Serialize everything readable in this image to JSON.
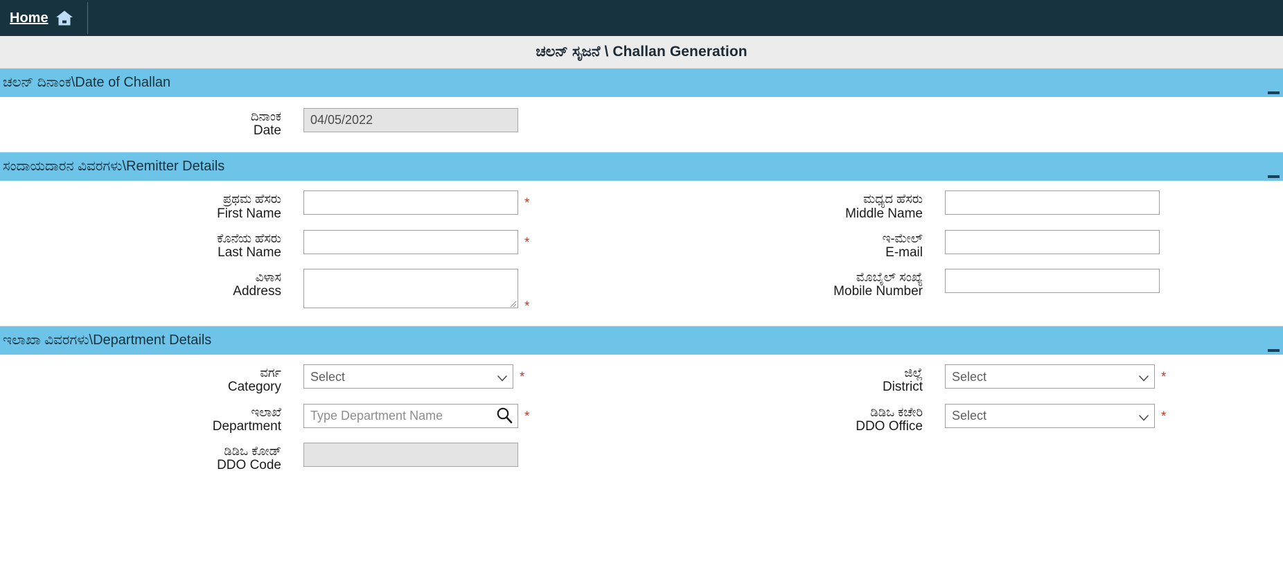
{
  "nav": {
    "home_label": "Home",
    "home_icon": "house-icon"
  },
  "header": {
    "title": "ಚಲನ್ ಸೃಜನೆ \\ Challan Generation"
  },
  "colors": {
    "nav_bg": "#16333f",
    "title_bg": "#ececec",
    "section_bg": "#6ec3e8",
    "required_mark": "#c0392b",
    "collapse_dash": "#17415c",
    "disabled_field": "#e4e4e4"
  },
  "sections": {
    "date": {
      "heading": "ಚಲನ್ ದಿನಾಂಕ\\Date of Challan",
      "collapse_label": "—",
      "fields": {
        "date": {
          "label_kn": "ದಿನಾಂಕ",
          "label_en": "Date",
          "value": "04/05/2022"
        }
      }
    },
    "remitter": {
      "heading": "ಸಂದಾಯದಾರನ ವಿವರಗಳು\\Remitter Details",
      "collapse_label": "—",
      "fields": {
        "first_name": {
          "label_kn": "ಪ್ರಥಮ ಹೆಸರು",
          "label_en": "First Name",
          "value": "",
          "required": "*"
        },
        "middle_name": {
          "label_kn": "ಮಧ್ಯದ ಹೆಸರು",
          "label_en": "Middle Name",
          "value": ""
        },
        "last_name": {
          "label_kn": "ಕೊನೆಯ ಹೆಸರು",
          "label_en": "Last Name",
          "value": "",
          "required": "*"
        },
        "email": {
          "label_kn": "ಇ-ಮೇಲ್",
          "label_en": "E-mail",
          "value": ""
        },
        "address": {
          "label_kn": "ವಿಳಾಸ",
          "label_en": "Address",
          "value": "",
          "required": "*"
        },
        "mobile": {
          "label_kn": "ಮೊಬೈಲ್ ಸಂಖ್ಯೆ",
          "label_en": "Mobile Number",
          "value": ""
        }
      }
    },
    "department": {
      "heading": "ಇಲಾಖಾ ವಿವರಗಳು\\Department Details",
      "collapse_label": "—",
      "fields": {
        "category": {
          "label_kn": "ವರ್ಗ",
          "label_en": "Category",
          "selected": "Select",
          "options": [
            "Select"
          ],
          "required": "*"
        },
        "district": {
          "label_kn": "ಜಿಲ್ಲೆ",
          "label_en": "District",
          "selected": "Select",
          "options": [
            "Select"
          ],
          "required": "*"
        },
        "department": {
          "label_kn": "ಇಲಾಖೆ",
          "label_en": "Department",
          "value": "",
          "placeholder": "Type Department Name",
          "icon": "search-icon",
          "required": "*"
        },
        "ddo_office": {
          "label_kn": "ಡಿಡಿಒ ಕಚೇರಿ",
          "label_en": "DDO Office",
          "selected": "Select",
          "options": [
            "Select"
          ],
          "required": "*"
        },
        "ddo_code": {
          "label_kn": "ಡಿಡಿಒ ಕೋಡ್",
          "label_en": "DDO Code",
          "value": ""
        }
      }
    }
  }
}
